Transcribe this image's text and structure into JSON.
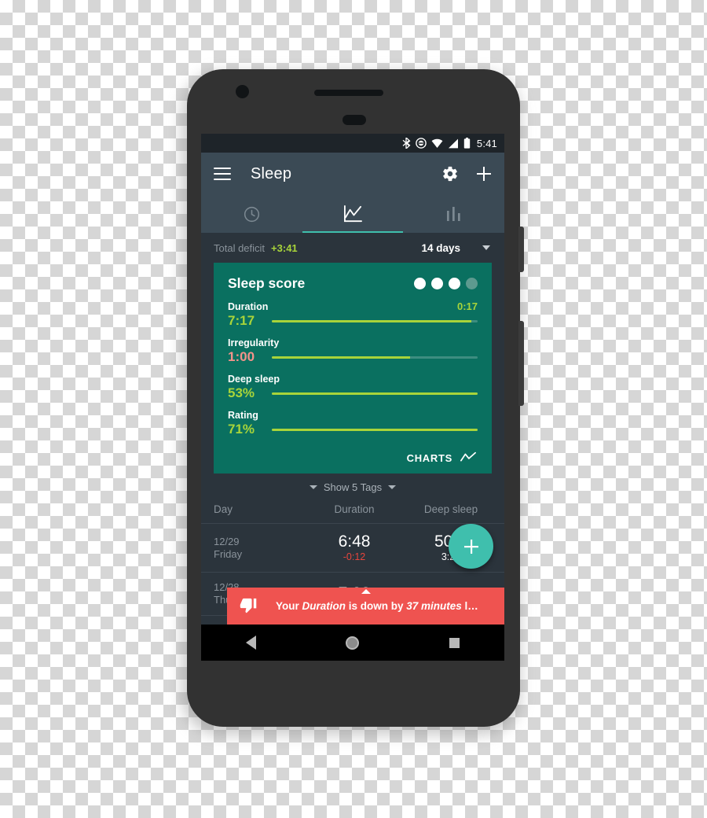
{
  "status_bar": {
    "time": "5:41",
    "icons": [
      "bluetooth-icon",
      "do-not-disturb-icon",
      "wifi-icon",
      "cellular-signal-icon",
      "battery-icon"
    ]
  },
  "app_bar": {
    "menu_icon": "hamburger-menu-icon",
    "title": "Sleep",
    "settings_icon": "gear-icon",
    "add_icon": "plus-icon"
  },
  "tabs": [
    {
      "name": "tab-clock",
      "icon": "clock-icon",
      "active": false
    },
    {
      "name": "tab-trends",
      "icon": "line-chart-icon",
      "active": true
    },
    {
      "name": "tab-stats",
      "icon": "bar-chart-icon",
      "active": false
    }
  ],
  "deficit": {
    "label": "Total deficit",
    "value": "+3:41",
    "range": "14 days",
    "caret_icon": "chevron-down-icon"
  },
  "sleep_card": {
    "title": "Sleep score",
    "score_dots": {
      "total": 4,
      "filled": 3
    },
    "metrics": [
      {
        "name": "Duration",
        "value": "7:17",
        "value_color": "green",
        "right": "0:17",
        "fill_pct": 97
      },
      {
        "name": "Irregularity",
        "value": "1:00",
        "value_color": "pink",
        "right": "",
        "fill_pct": 67
      },
      {
        "name": "Deep sleep",
        "value": "53%",
        "value_color": "green",
        "right": "",
        "fill_pct": 100
      },
      {
        "name": "Rating",
        "value": "71%",
        "value_color": "green",
        "right": "",
        "fill_pct": 100
      }
    ],
    "charts_label": "CHARTS",
    "charts_icon": "line-chart-icon"
  },
  "tags": {
    "label": "Show 5 Tags",
    "left_caret_icon": "caret-down-icon",
    "right_caret_icon": "caret-down-icon"
  },
  "table": {
    "columns": [
      "Day",
      "Duration",
      "Deep sleep"
    ],
    "rows": [
      {
        "date": "12/29",
        "weekday": "Friday",
        "duration": "6:48",
        "duration_delta": "-0:12",
        "deep_sleep": "50%",
        "deep_sleep_time": "3:24"
      },
      {
        "date": "12/28",
        "weekday": "Thursday",
        "duration": "7:28",
        "duration_delta": "",
        "deep_sleep": "",
        "deep_sleep_time": ""
      }
    ]
  },
  "fab": {
    "icon": "plus-icon"
  },
  "snackbar": {
    "icon": "thumbs-down-icon",
    "text": "Your Duration is down by 37 minutes l…",
    "background": "#ef5350"
  },
  "nav_bar": {
    "back": "back-triangle-icon",
    "home": "home-circle-icon",
    "recents": "recents-square-icon"
  },
  "colors": {
    "card_teal": "#0a7060",
    "accent_teal": "#3fbfad",
    "lime": "#a8d43a",
    "salmon": "#f4938b",
    "app_bar": "#3b4a55",
    "screen_bg": "#2b343c",
    "status_bg": "#1e2429",
    "red": "#e8453c"
  }
}
